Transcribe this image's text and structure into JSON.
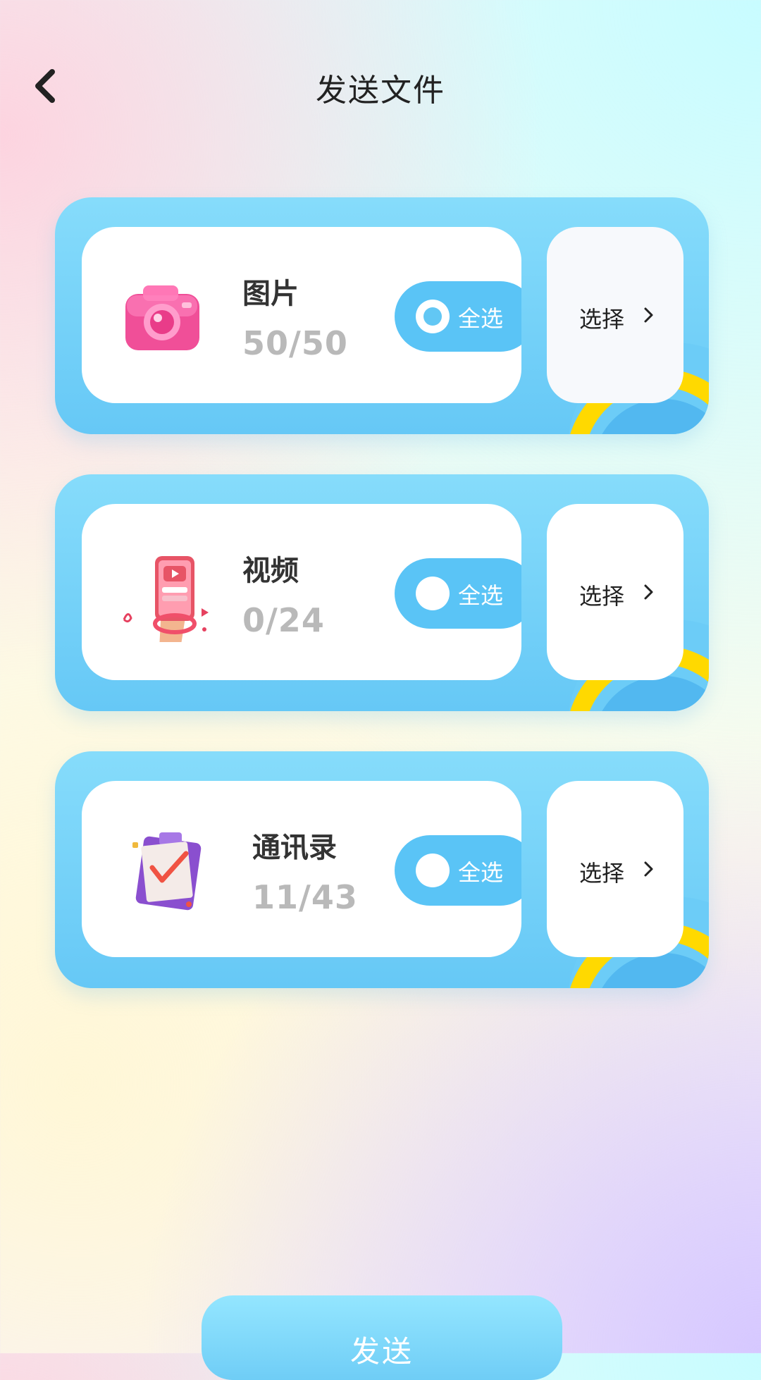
{
  "header": {
    "title": "发送文件",
    "back_icon": "chevron-left-icon"
  },
  "items": [
    {
      "name": "图片",
      "count": "50/50",
      "select_all_label": "全选",
      "select_all_checked": true,
      "select_label": "选择",
      "icon": "camera-icon"
    },
    {
      "name": "视频",
      "count": "0/24",
      "select_all_label": "全选",
      "select_all_checked": false,
      "select_label": "选择",
      "icon": "video-phone-icon"
    },
    {
      "name": "通讯录",
      "count": "11/43",
      "select_all_label": "全选",
      "select_all_checked": false,
      "select_label": "选择",
      "icon": "clipboard-icon"
    }
  ],
  "footer": {
    "send_label": "发送"
  },
  "colors": {
    "accent": "#5ac4f6",
    "card": "#7fd6fa",
    "deco_yellow": "#ffd900",
    "count_text": "#b9b9b9"
  }
}
